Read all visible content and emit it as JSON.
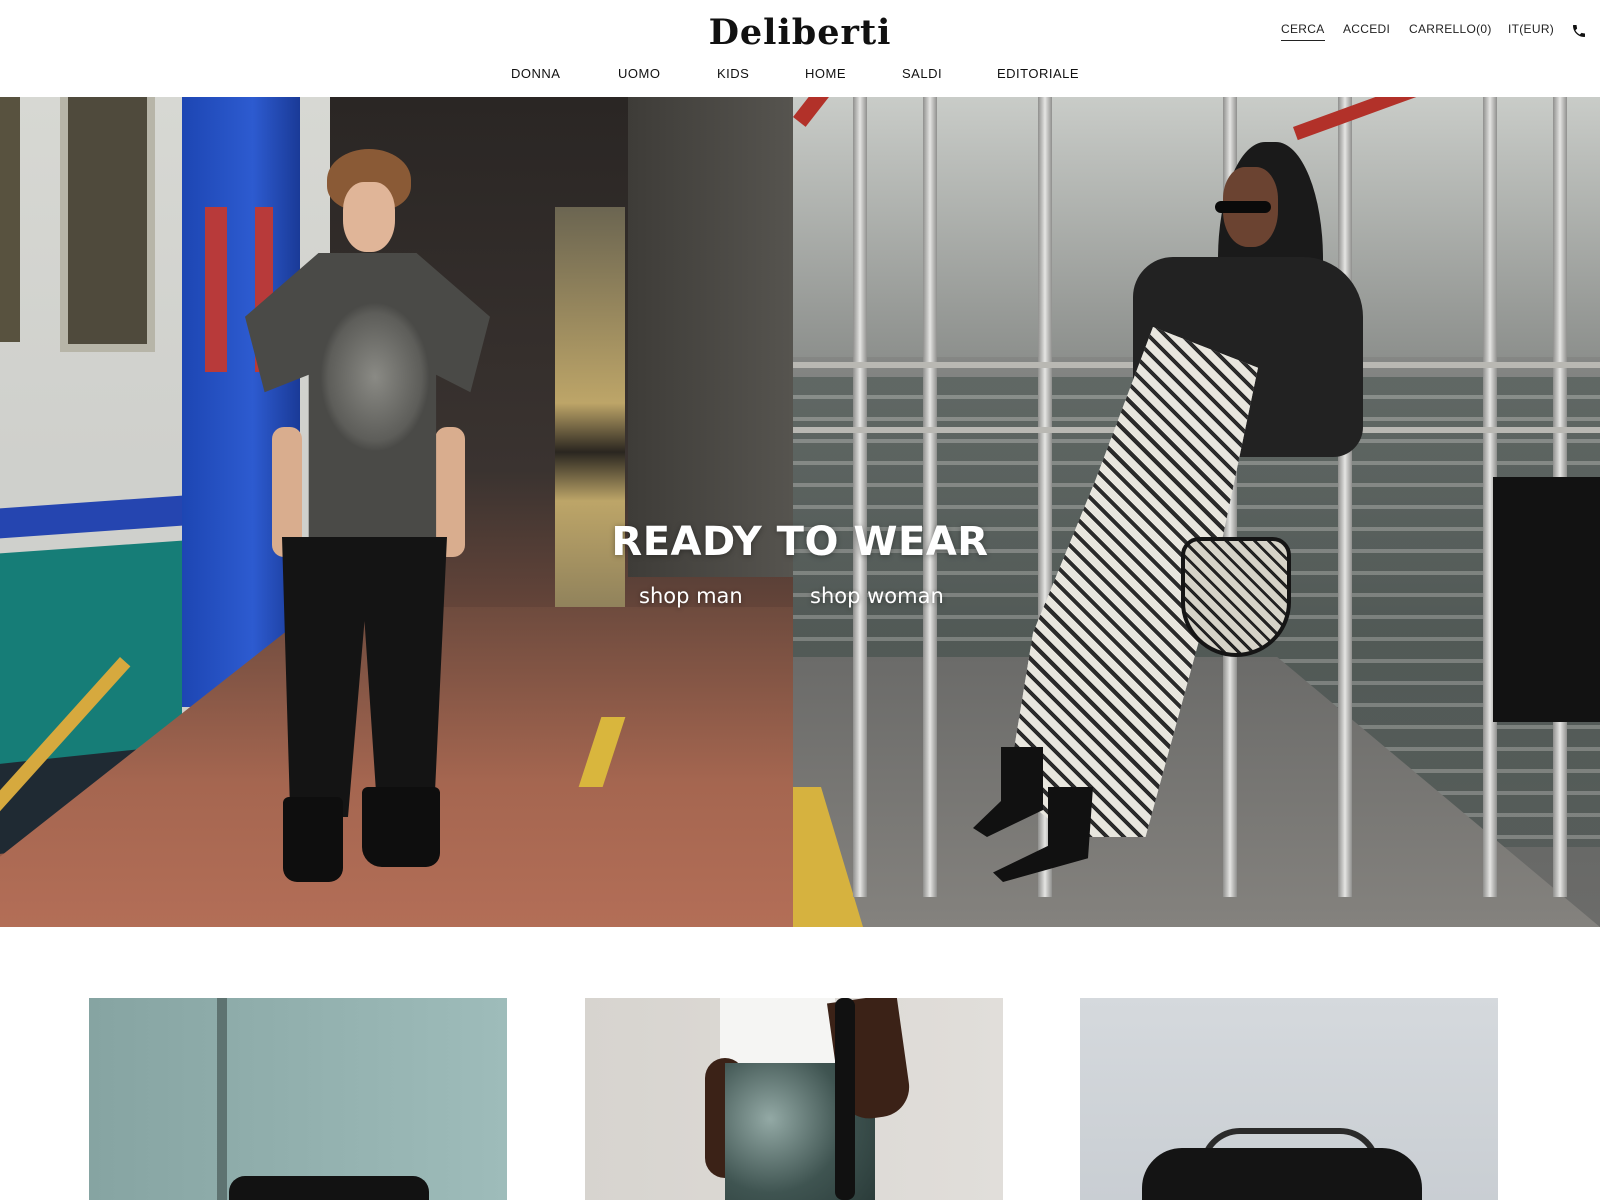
{
  "brand": {
    "name": "Deliberti"
  },
  "top_links": {
    "search": "CERCA",
    "login": "ACCEDI",
    "cart": "CARRELLO(0)",
    "locale": "IT(EUR)",
    "phone_icon": "phone-icon"
  },
  "nav": {
    "items": [
      {
        "label": "DONNA"
      },
      {
        "label": "UOMO"
      },
      {
        "label": "KIDS"
      },
      {
        "label": "HOME"
      },
      {
        "label": "SALDI"
      },
      {
        "label": "EDITORIALE"
      }
    ]
  },
  "hero": {
    "title": "READY TO WEAR",
    "shop_man": "shop man",
    "shop_woman": "shop woman"
  },
  "colors": {
    "text": "#111111",
    "background": "#ffffff",
    "hero_text": "#ffffff"
  }
}
